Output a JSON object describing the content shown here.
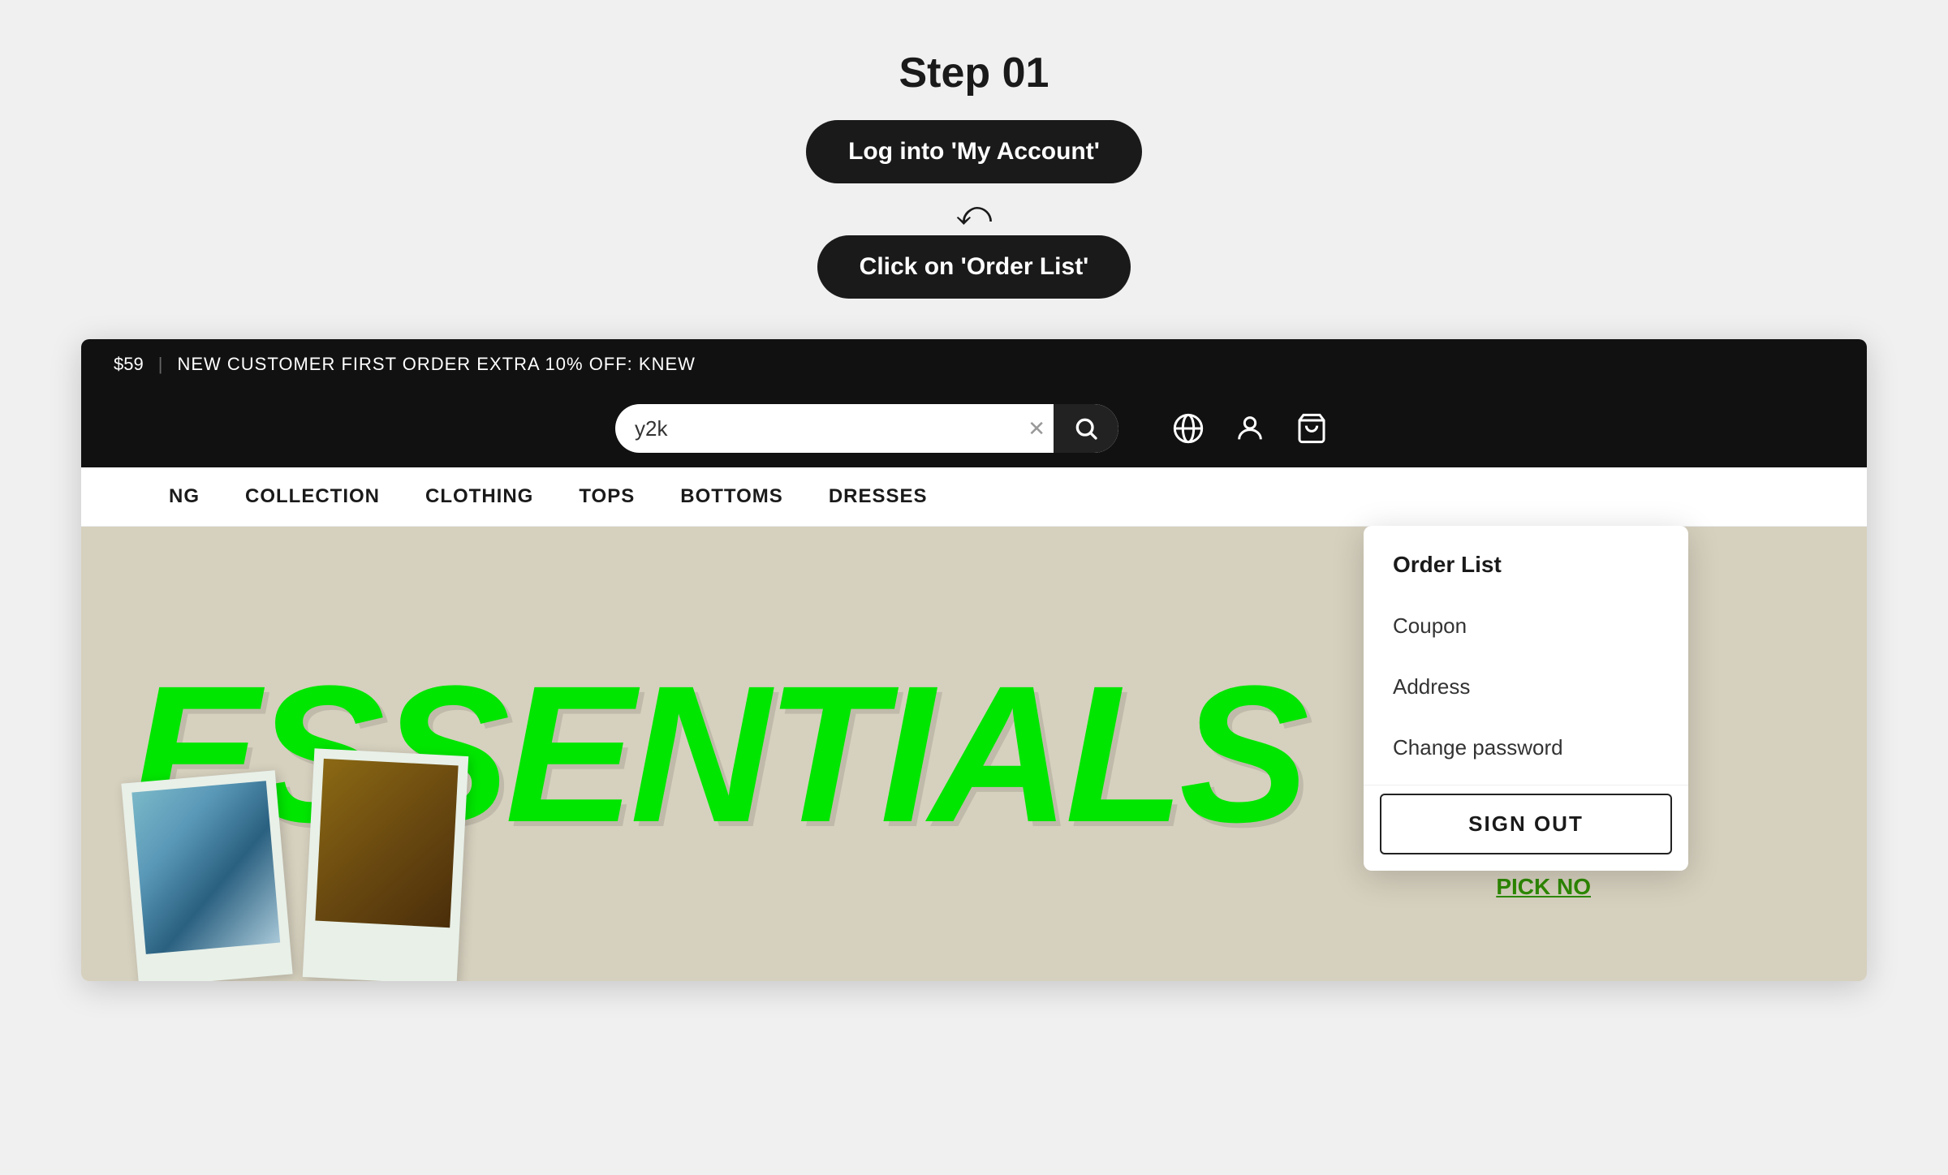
{
  "page": {
    "background": "#f0f0f0"
  },
  "instructions": {
    "step_label": "Step 01",
    "button1_label": "Log into 'My Account'",
    "chevron": "❯❯",
    "button2_label": "Click on 'Order List'"
  },
  "topbar": {
    "price": "$59",
    "divider": "|",
    "promo": "NEW CUSTOMER FIRST ORDER EXTRA 10% OFF: KNEW"
  },
  "header": {
    "search_value": "y2k",
    "search_placeholder": "Search"
  },
  "nav": {
    "items": [
      {
        "label": "NG"
      },
      {
        "label": "COLLECTION"
      },
      {
        "label": "CLOTHING"
      },
      {
        "label": "TOPS"
      },
      {
        "label": "BOTTOMS"
      },
      {
        "label": "DRESSES"
      }
    ]
  },
  "dropdown": {
    "items": [
      {
        "label": "Order List",
        "active": true
      },
      {
        "label": "Coupon",
        "active": false
      },
      {
        "label": "Address",
        "active": false
      },
      {
        "label": "Change password",
        "active": false
      }
    ],
    "signout_label": "SIGN OUT"
  },
  "hero": {
    "text": "ESSENTIALS",
    "pick_now": "PICK NO"
  },
  "icons": {
    "globe": "🌐",
    "user": "👤",
    "cart": "🛍",
    "search": "🔍",
    "clear": "✕"
  }
}
